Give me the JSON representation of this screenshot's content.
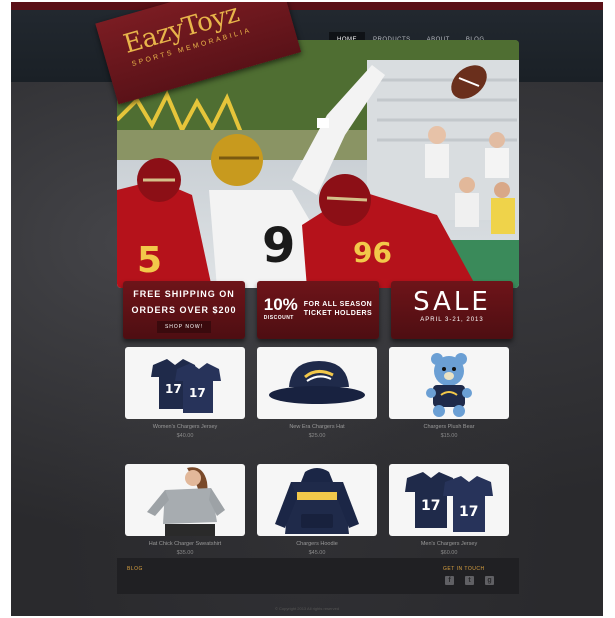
{
  "nav": {
    "items": [
      "HOME",
      "PRODUCTS",
      "ABOUT",
      "BLOG"
    ],
    "active": "HOME"
  },
  "logo": {
    "name": "EazyToyz",
    "tagline": "SPORTS MEMORABILIA"
  },
  "hero": {
    "jersey_number_front": "9",
    "jersey_number_red": "96",
    "jersey_number_left": "5"
  },
  "promos": {
    "shipping": {
      "line1": "FREE SHIPPING ON",
      "line2": "ORDERS OVER $200",
      "button": "SHOP NOW!"
    },
    "discount": {
      "percent": "10%",
      "word": "DISCOUNT",
      "line1": "FOR ALL SEASON",
      "line2": "TICKET HOLDERS"
    },
    "sale": {
      "title": "SALE",
      "date": "APRIL 3-21, 2013"
    }
  },
  "products": [
    {
      "name": "Women's Chargers Jersey",
      "price": "$40.00",
      "icon": "jersey-icon"
    },
    {
      "name": "New Era Chargers Hat",
      "price": "$25.00",
      "icon": "cap-icon"
    },
    {
      "name": "Chargers Plush Bear",
      "price": "$15.00",
      "icon": "plush-bear-icon"
    },
    {
      "name": "Hat Chick Charger Sweatshirt",
      "price": "$35.00",
      "icon": "sweatshirt-icon"
    },
    {
      "name": "Chargers Hoodie",
      "price": "$45.00",
      "icon": "hoodie-icon"
    },
    {
      "name": "Men's Chargers Jersey",
      "price": "$60.00",
      "icon": "jersey-icon"
    }
  ],
  "footer": {
    "blog": "BLOG",
    "get_in_touch": "GET IN TOUCH",
    "social": [
      "f",
      "t",
      "g"
    ]
  },
  "copyright": "© Copyright 2013 All rights reserved",
  "colors": {
    "brand_red": "#6e1419",
    "gold": "#e8b54a",
    "navy": "#1f2a4a",
    "background": "#2a2a2d"
  }
}
